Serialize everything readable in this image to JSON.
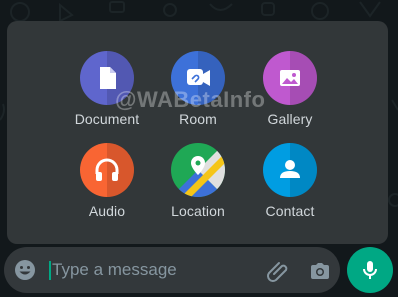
{
  "attach_menu": {
    "items": [
      {
        "label": "Document",
        "icon": "document-icon",
        "color": "#5f66cd"
      },
      {
        "label": "Room",
        "icon": "room-icon",
        "color": "#3d71d9"
      },
      {
        "label": "Gallery",
        "icon": "gallery-icon",
        "color": "#bf59cf"
      },
      {
        "label": "Audio",
        "icon": "headphones-icon",
        "color": "#f96533"
      },
      {
        "label": "Location",
        "icon": "location-icon",
        "color": "#1fa855"
      },
      {
        "label": "Contact",
        "icon": "contact-icon",
        "color": "#009de2"
      }
    ]
  },
  "watermark": "@WABetaInfo",
  "composer": {
    "placeholder": "Type a message",
    "accent_color": "#00a884"
  }
}
